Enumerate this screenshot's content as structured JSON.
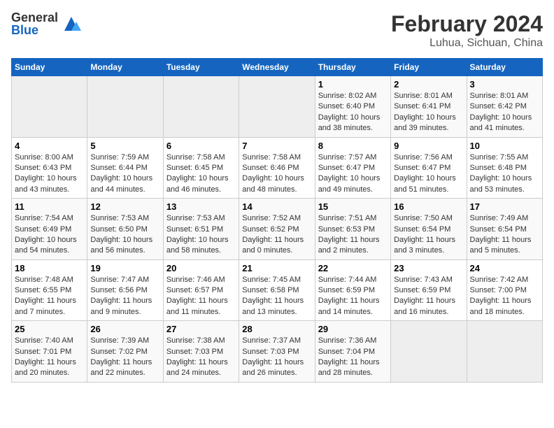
{
  "header": {
    "logo_general": "General",
    "logo_blue": "Blue",
    "title": "February 2024",
    "subtitle": "Luhua, Sichuan, China"
  },
  "weekdays": [
    "Sunday",
    "Monday",
    "Tuesday",
    "Wednesday",
    "Thursday",
    "Friday",
    "Saturday"
  ],
  "weeks": [
    [
      {
        "day": "",
        "info": ""
      },
      {
        "day": "",
        "info": ""
      },
      {
        "day": "",
        "info": ""
      },
      {
        "day": "",
        "info": ""
      },
      {
        "day": "1",
        "info": "Sunrise: 8:02 AM\nSunset: 6:40 PM\nDaylight: 10 hours\nand 38 minutes."
      },
      {
        "day": "2",
        "info": "Sunrise: 8:01 AM\nSunset: 6:41 PM\nDaylight: 10 hours\nand 39 minutes."
      },
      {
        "day": "3",
        "info": "Sunrise: 8:01 AM\nSunset: 6:42 PM\nDaylight: 10 hours\nand 41 minutes."
      }
    ],
    [
      {
        "day": "4",
        "info": "Sunrise: 8:00 AM\nSunset: 6:43 PM\nDaylight: 10 hours\nand 43 minutes."
      },
      {
        "day": "5",
        "info": "Sunrise: 7:59 AM\nSunset: 6:44 PM\nDaylight: 10 hours\nand 44 minutes."
      },
      {
        "day": "6",
        "info": "Sunrise: 7:58 AM\nSunset: 6:45 PM\nDaylight: 10 hours\nand 46 minutes."
      },
      {
        "day": "7",
        "info": "Sunrise: 7:58 AM\nSunset: 6:46 PM\nDaylight: 10 hours\nand 48 minutes."
      },
      {
        "day": "8",
        "info": "Sunrise: 7:57 AM\nSunset: 6:47 PM\nDaylight: 10 hours\nand 49 minutes."
      },
      {
        "day": "9",
        "info": "Sunrise: 7:56 AM\nSunset: 6:47 PM\nDaylight: 10 hours\nand 51 minutes."
      },
      {
        "day": "10",
        "info": "Sunrise: 7:55 AM\nSunset: 6:48 PM\nDaylight: 10 hours\nand 53 minutes."
      }
    ],
    [
      {
        "day": "11",
        "info": "Sunrise: 7:54 AM\nSunset: 6:49 PM\nDaylight: 10 hours\nand 54 minutes."
      },
      {
        "day": "12",
        "info": "Sunrise: 7:53 AM\nSunset: 6:50 PM\nDaylight: 10 hours\nand 56 minutes."
      },
      {
        "day": "13",
        "info": "Sunrise: 7:53 AM\nSunset: 6:51 PM\nDaylight: 10 hours\nand 58 minutes."
      },
      {
        "day": "14",
        "info": "Sunrise: 7:52 AM\nSunset: 6:52 PM\nDaylight: 11 hours\nand 0 minutes."
      },
      {
        "day": "15",
        "info": "Sunrise: 7:51 AM\nSunset: 6:53 PM\nDaylight: 11 hours\nand 2 minutes."
      },
      {
        "day": "16",
        "info": "Sunrise: 7:50 AM\nSunset: 6:54 PM\nDaylight: 11 hours\nand 3 minutes."
      },
      {
        "day": "17",
        "info": "Sunrise: 7:49 AM\nSunset: 6:54 PM\nDaylight: 11 hours\nand 5 minutes."
      }
    ],
    [
      {
        "day": "18",
        "info": "Sunrise: 7:48 AM\nSunset: 6:55 PM\nDaylight: 11 hours\nand 7 minutes."
      },
      {
        "day": "19",
        "info": "Sunrise: 7:47 AM\nSunset: 6:56 PM\nDaylight: 11 hours\nand 9 minutes."
      },
      {
        "day": "20",
        "info": "Sunrise: 7:46 AM\nSunset: 6:57 PM\nDaylight: 11 hours\nand 11 minutes."
      },
      {
        "day": "21",
        "info": "Sunrise: 7:45 AM\nSunset: 6:58 PM\nDaylight: 11 hours\nand 13 minutes."
      },
      {
        "day": "22",
        "info": "Sunrise: 7:44 AM\nSunset: 6:59 PM\nDaylight: 11 hours\nand 14 minutes."
      },
      {
        "day": "23",
        "info": "Sunrise: 7:43 AM\nSunset: 6:59 PM\nDaylight: 11 hours\nand 16 minutes."
      },
      {
        "day": "24",
        "info": "Sunrise: 7:42 AM\nSunset: 7:00 PM\nDaylight: 11 hours\nand 18 minutes."
      }
    ],
    [
      {
        "day": "25",
        "info": "Sunrise: 7:40 AM\nSunset: 7:01 PM\nDaylight: 11 hours\nand 20 minutes."
      },
      {
        "day": "26",
        "info": "Sunrise: 7:39 AM\nSunset: 7:02 PM\nDaylight: 11 hours\nand 22 minutes."
      },
      {
        "day": "27",
        "info": "Sunrise: 7:38 AM\nSunset: 7:03 PM\nDaylight: 11 hours\nand 24 minutes."
      },
      {
        "day": "28",
        "info": "Sunrise: 7:37 AM\nSunset: 7:03 PM\nDaylight: 11 hours\nand 26 minutes."
      },
      {
        "day": "29",
        "info": "Sunrise: 7:36 AM\nSunset: 7:04 PM\nDaylight: 11 hours\nand 28 minutes."
      },
      {
        "day": "",
        "info": ""
      },
      {
        "day": "",
        "info": ""
      }
    ]
  ]
}
